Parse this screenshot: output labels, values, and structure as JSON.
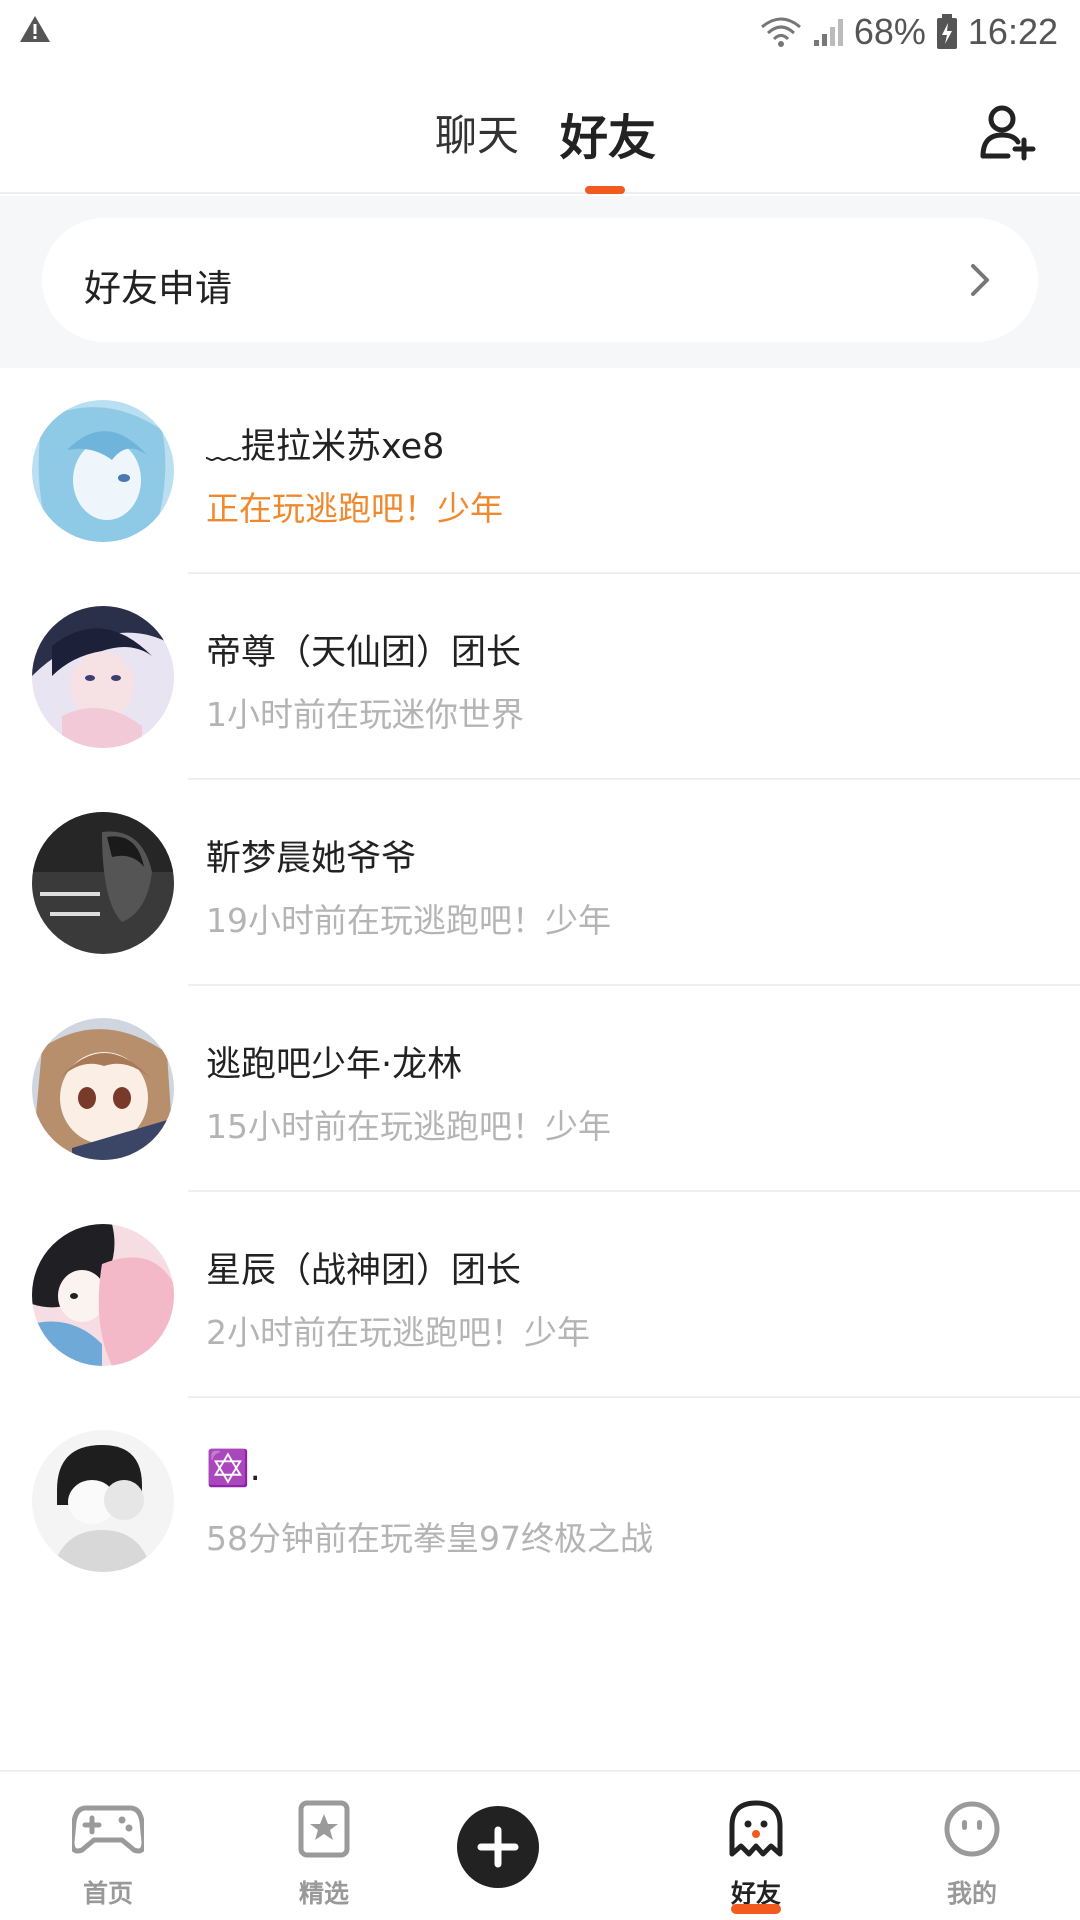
{
  "status_bar": {
    "battery": "68%",
    "time": "16:22"
  },
  "header": {
    "tabs": [
      {
        "label": "聊天",
        "active": false
      },
      {
        "label": "好友",
        "active": true
      }
    ],
    "add_friend_icon": "add-user-icon",
    "accent_color": "#f25a1f"
  },
  "friend_request": {
    "label": "好友申请"
  },
  "friends": [
    {
      "name": "﹏提拉米苏xe8",
      "activity": "正在玩逃跑吧！少年",
      "online": true
    },
    {
      "name": "帝尊（天仙团）团长",
      "activity": "1小时前在玩迷你世界",
      "online": false
    },
    {
      "name": "靳梦晨她爷爷",
      "activity": "19小时前在玩逃跑吧！少年",
      "online": false
    },
    {
      "name": "逃跑吧少年·龙林",
      "activity": "15小时前在玩逃跑吧！少年",
      "online": false
    },
    {
      "name": "星辰（战神团）团长",
      "activity": "2小时前在玩逃跑吧！少年",
      "online": false
    },
    {
      "name": "✡️.",
      "activity": "58分钟前在玩拳皇97终极之战",
      "online": false
    }
  ],
  "bottom_nav": [
    {
      "label": "首页",
      "icon": "gamepad-icon",
      "active": false
    },
    {
      "label": "精选",
      "icon": "star-bookmark-icon",
      "active": false
    },
    {
      "label": "",
      "icon": "plus-icon",
      "active": false
    },
    {
      "label": "好友",
      "icon": "ghost-icon",
      "active": true
    },
    {
      "label": "我的",
      "icon": "face-icon",
      "active": false
    }
  ]
}
